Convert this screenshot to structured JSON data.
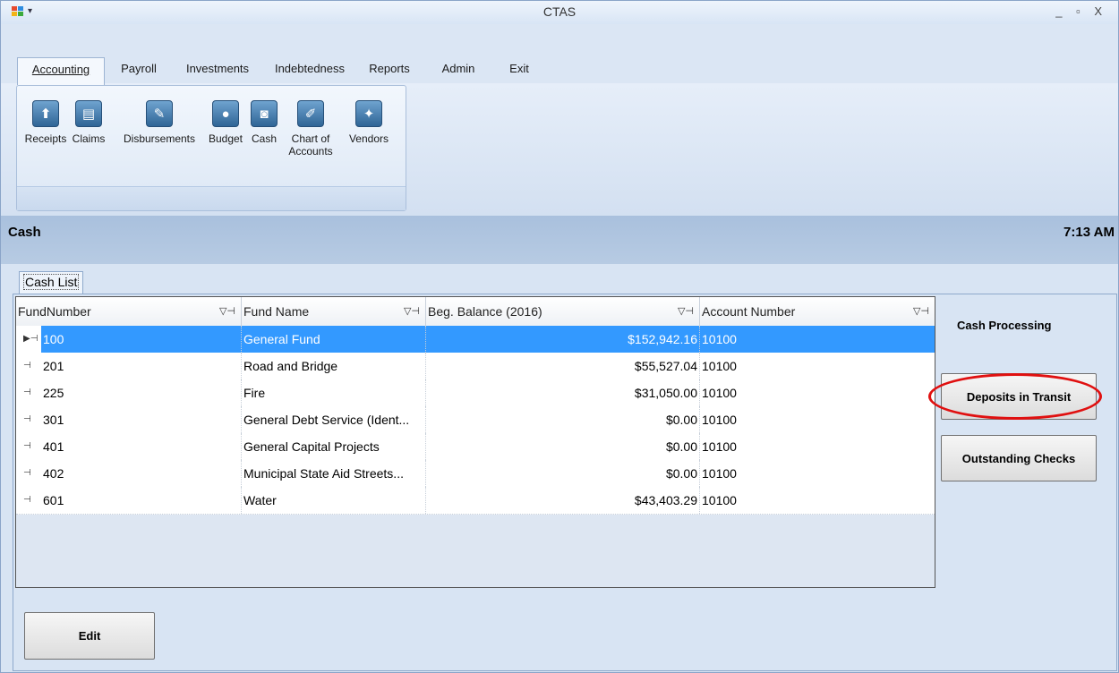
{
  "window": {
    "title": "CTAS",
    "controls": "_ ▫ X"
  },
  "menu_tabs": [
    {
      "label": "Accounting",
      "active": true
    },
    {
      "label": "Payroll"
    },
    {
      "label": "Investments"
    },
    {
      "label": "Indebtedness"
    },
    {
      "label": "Reports"
    },
    {
      "label": "Admin"
    },
    {
      "label": "Exit"
    }
  ],
  "ribbon": {
    "buttons": [
      {
        "label": "Receipts",
        "icon": "receipts-icon",
        "glyph": "⬆"
      },
      {
        "label": "Claims",
        "icon": "claims-icon",
        "glyph": "▤"
      },
      {
        "label": "Disbursements",
        "icon": "disbursements-icon",
        "glyph": "✎"
      },
      {
        "label": "Budget",
        "icon": "budget-icon",
        "glyph": "●"
      },
      {
        "label": "Cash",
        "icon": "cash-icon",
        "glyph": "◙"
      },
      {
        "label": "Chart of",
        "label2": "Accounts",
        "icon": "chart-of-accounts-icon",
        "glyph": "✐"
      },
      {
        "label": "Vendors",
        "icon": "vendors-icon",
        "glyph": "✦"
      }
    ]
  },
  "status": {
    "title": "Cash",
    "time": "7:13 AM"
  },
  "tab": {
    "label": "Cash List"
  },
  "grid": {
    "columns": [
      "FundNumber",
      "Fund Name",
      "Beg. Balance (2016)",
      "Account Number"
    ],
    "rows": [
      {
        "fund": "100",
        "name": "General Fund",
        "balance": "$152,942.16",
        "account": "10100",
        "selected": true
      },
      {
        "fund": "201",
        "name": "Road and Bridge",
        "balance": "$55,527.04",
        "account": "10100"
      },
      {
        "fund": "225",
        "name": "Fire",
        "balance": "$31,050.00",
        "account": "10100"
      },
      {
        "fund": "301",
        "name": "General Debt Service (Ident...",
        "balance": "$0.00",
        "account": "10100"
      },
      {
        "fund": "401",
        "name": "General Capital Projects",
        "balance": "$0.00",
        "account": "10100"
      },
      {
        "fund": "402",
        "name": "Municipal State Aid Streets...",
        "balance": "$0.00",
        "account": "10100"
      },
      {
        "fund": "601",
        "name": "Water",
        "balance": "$43,403.29",
        "account": "10100"
      }
    ]
  },
  "side": {
    "title": "Cash Processing",
    "deposits_label": "Deposits in Transit",
    "outstanding_label": "Outstanding Checks"
  },
  "edit_label": "Edit",
  "colors": {
    "selection": "#3399ff",
    "highlight_circle": "#e01010"
  }
}
